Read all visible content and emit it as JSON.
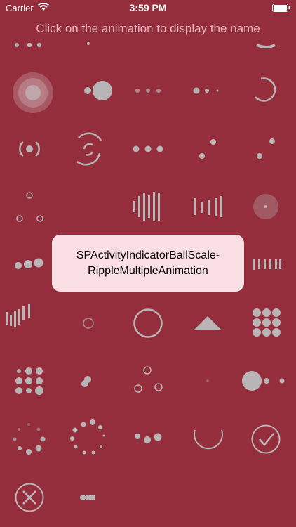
{
  "status_bar": {
    "carrier": "Carrier",
    "time": "3:59 PM"
  },
  "header": {
    "text": "Click on the animation to display the name"
  },
  "tooltip": {
    "line1": "SPActivityIndicatorBallScale-",
    "line2": "RippleMultipleAnimation"
  },
  "colors": {
    "background": "#952e3c",
    "indicator": "#b9b4b5",
    "tooltip_bg": "#f9dfe3"
  },
  "animations": [
    "ball-partial-top-row",
    "beat-partial-top-row",
    "empty-top-row",
    "empty-top-row",
    "ring-partial-top-row",
    "ball-scale-ripple-multiple",
    "ball-pulse-sync-large",
    "ball-pulse-small",
    "ball-pulse-decreasing",
    "arc-spinner",
    "ball-scale-ripple",
    "ball-rotate-arcs",
    "ball-pulse-three",
    "ball-zig-zag",
    "ball-zig-zag-deflect",
    "ball-triangle-path-small",
    "audio-equalizer-large",
    "audio-equalizer-medium",
    "empty",
    "ball-scale-fade",
    "ball-pulse-rise",
    "empty",
    "empty",
    "empty",
    "line-scale-pulse-out",
    "line-scale-party",
    "ball-scale-ring-small",
    "circle-stroke",
    "triangle",
    "ball-grid-pulse",
    "ball-grid-beat",
    "ball-rotate",
    "ball-triangle-path",
    "ball-scale-tiny",
    "ball-pulse-grow",
    "ball-spin-fade-loader",
    "ball-spin-fade-dots",
    "ball-beat-cluster",
    "circle-arc",
    "checkmark-circle",
    "cross-circle",
    "ball-pulse-horizontal"
  ]
}
